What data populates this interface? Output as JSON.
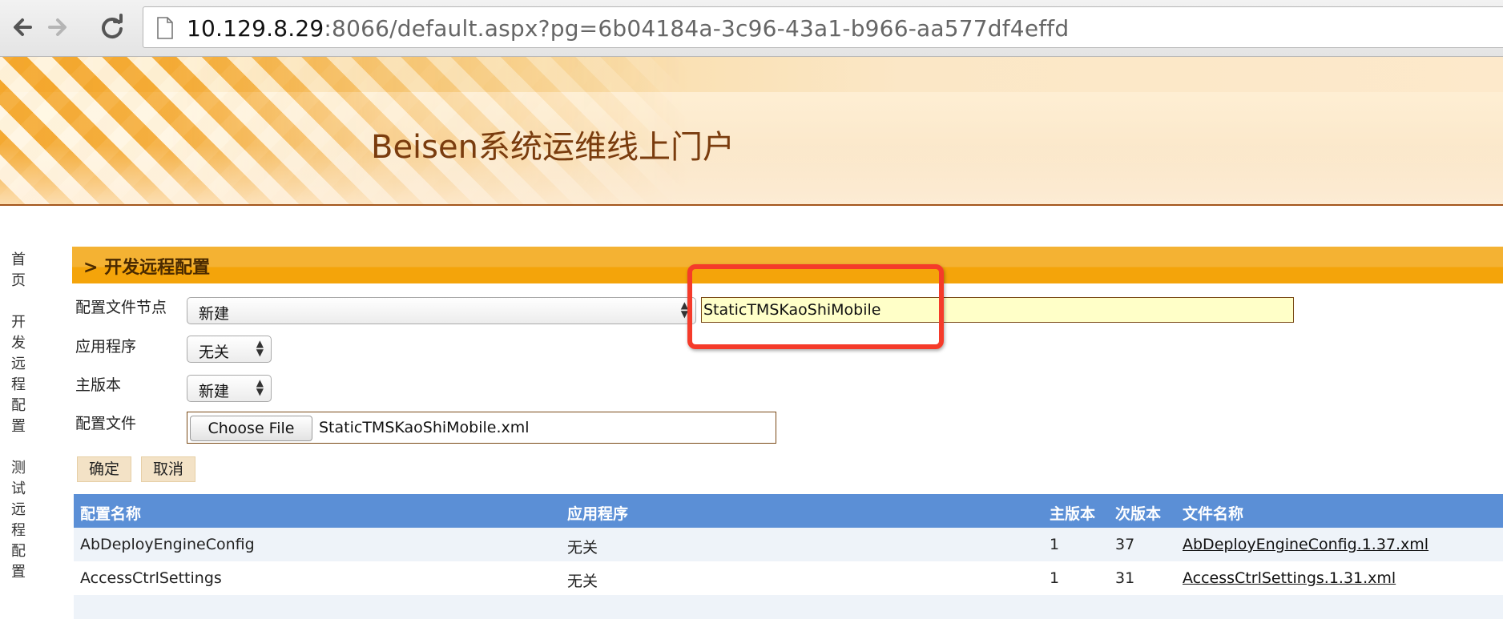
{
  "browser": {
    "url_host": "10.129.8.29",
    "url_path": ":8066/default.aspx?pg=6b04184a-3c96-43a1-b966-aa577df4effd"
  },
  "header": {
    "title": "Beisen系统运维线上门户"
  },
  "sidebar": {
    "items": [
      {
        "label": "首页"
      },
      {
        "label": "开发远程配置"
      },
      {
        "label": "测试远程配置"
      }
    ]
  },
  "section": {
    "title": "> 开发远程配置"
  },
  "form": {
    "config_node_label": "配置文件节点",
    "config_node_value": "新建",
    "config_node_name_value": "StaticTMSKaoShiMobile",
    "app_label": "应用程序",
    "app_value": "无关",
    "major_label": "主版本",
    "major_value": "新建",
    "file_label": "配置文件",
    "file_button": "Choose File",
    "file_name": "StaticTMSKaoShiMobile.xml",
    "ok_button": "确定",
    "cancel_button": "取消"
  },
  "table": {
    "headers": [
      "配置名称",
      "应用程序",
      "主版本",
      "次版本",
      "文件名称"
    ],
    "rows": [
      [
        "AbDeployEngineConfig",
        "无关",
        "1",
        "37",
        "AbDeployEngineConfig.1.37.xml"
      ],
      [
        "AccessCtrlSettings",
        "无关",
        "1",
        "31",
        "AccessCtrlSettings.1.31.xml"
      ]
    ]
  },
  "colors": {
    "section_bar": "#f4a40a",
    "table_header": "#5b8fd6",
    "input_highlight": "#ffffc8",
    "annotation_box": "#f53b2a",
    "banner_title": "#7a3c0e"
  }
}
